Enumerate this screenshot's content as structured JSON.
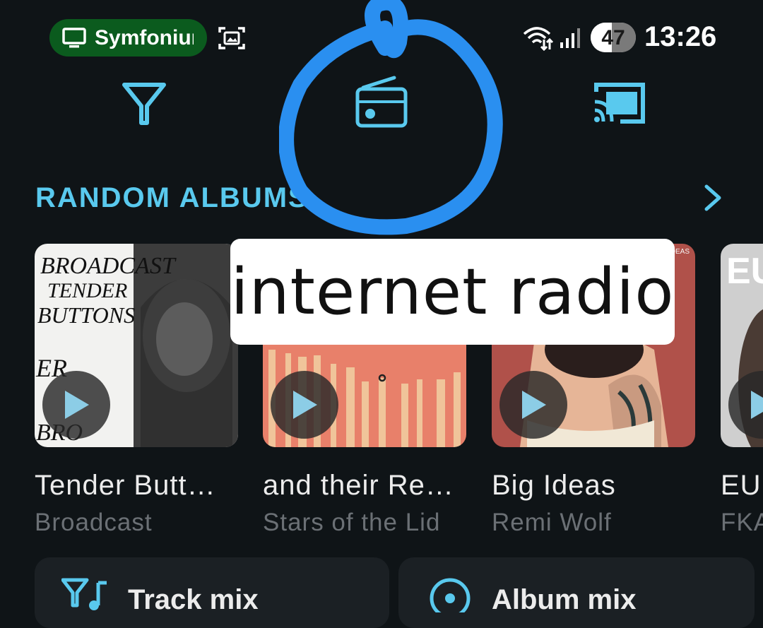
{
  "status_bar": {
    "cast_app": "Symfonium",
    "battery": "47",
    "battery_level": 0.47,
    "time": "13:26",
    "icons": [
      "tv-icon",
      "screenshot-icon",
      "wifi-icon",
      "signal-icon"
    ]
  },
  "toolbar": {
    "icons": [
      "filter-icon",
      "radio-icon",
      "cast-icon"
    ],
    "accent_color": "#59c9ee"
  },
  "section": {
    "title": "RANDOM ALBUMS"
  },
  "albums": [
    {
      "title": "Tender Butt…",
      "artist": "Broadcast",
      "cover_text": [
        "BROADCAST",
        "TENDER",
        "BUTTONS",
        "ER",
        "BRO"
      ]
    },
    {
      "title": "and their Re…",
      "artist": "Stars of the Lid"
    },
    {
      "title": "Big Ideas",
      "artist": "Remi Wolf",
      "cover_text": "IDEAS"
    },
    {
      "title": "EU",
      "artist": "FKA",
      "cover_text": "EU"
    }
  ],
  "mixes": [
    {
      "label": "Track mix",
      "icon": "track-mix-icon"
    },
    {
      "label": "Album mix",
      "icon": "album-mix-icon"
    }
  ],
  "annotation": {
    "label": "internet radio",
    "circle_color": "#2a8ff0"
  }
}
